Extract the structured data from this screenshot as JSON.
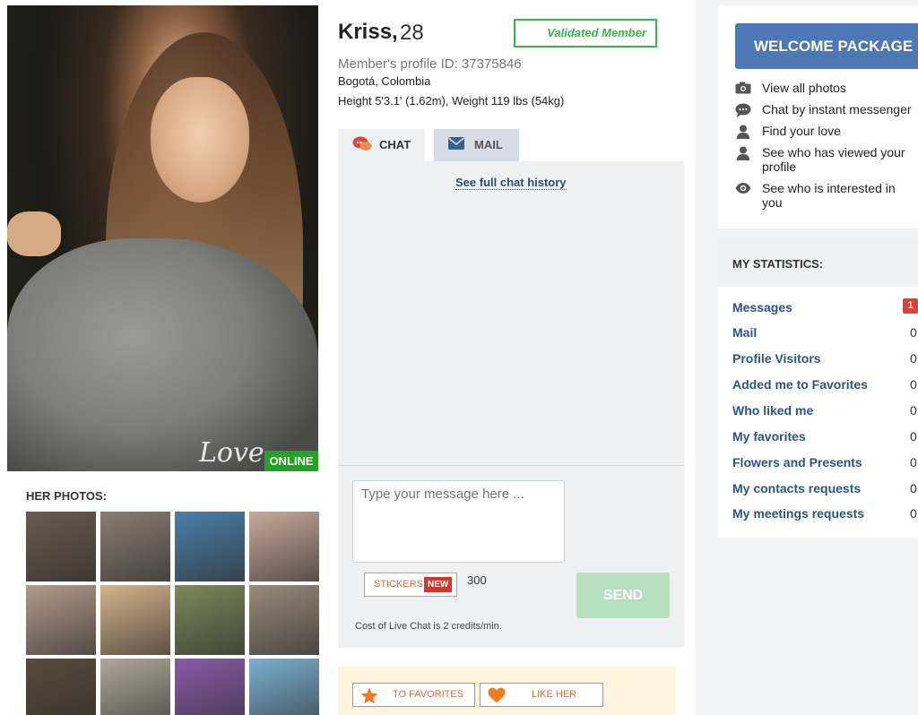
{
  "profile": {
    "name": "Kriss,",
    "age": "28",
    "validated_label": "Validated Member",
    "profile_id": "Member's profile ID: 37375846",
    "location": "Bogotá, Colombia",
    "measurements": "Height 5'3.1' (1.62m), Weight 119 lbs (54kg)"
  },
  "photo": {
    "watermark": "Love.",
    "status": "ONLINE"
  },
  "photos": {
    "title": "HER PHOTOS:",
    "thumb_colors": [
      "#6b5a4d",
      "#8a7d72",
      "#4b7fa8",
      "#c9a89a",
      "#b59a8a",
      "#d4b48a",
      "#7a8a5a",
      "#9a8a7a",
      "#5a4a3a",
      "#b0a898",
      "#8a5aa8",
      "#7ab0d0"
    ]
  },
  "tabs": {
    "chat": "CHAT",
    "mail": "MAIL"
  },
  "chat": {
    "history_link": "See full chat history",
    "input_placeholder": "Type your message here ...",
    "stickers_label": "STICKERS",
    "new_badge": "NEW",
    "char_count": "300",
    "send_label": "SEND",
    "cost_note": "Cost of Live Chat is 2 credits/min."
  },
  "actions": {
    "favorites": "TO FAVORITES",
    "like": "LIKE HER"
  },
  "welcome": {
    "button": "WELCOME PACKAGE",
    "perks": [
      {
        "label": "View all photos",
        "icon": "camera-icon"
      },
      {
        "label": "Chat by instant messenger",
        "icon": "chat-bubble-icon"
      },
      {
        "label": "Find your love",
        "icon": "user-icon"
      },
      {
        "label": "See who has viewed your profile",
        "icon": "user-icon"
      },
      {
        "label": "See who is interested in you",
        "icon": "eye-icon"
      }
    ]
  },
  "stats": {
    "title": "MY STATISTICS:",
    "rows": [
      {
        "label": "Messages",
        "value": "1",
        "highlight": true
      },
      {
        "label": "Mail",
        "value": "0"
      },
      {
        "label": "Profile Visitors",
        "value": "0"
      },
      {
        "label": "Added me to Favorites",
        "value": "0"
      },
      {
        "label": "Who liked me",
        "value": "0"
      },
      {
        "label": "My favorites",
        "value": "0"
      },
      {
        "label": "Flowers and Presents",
        "value": "0"
      },
      {
        "label": "My contacts requests",
        "value": "0"
      },
      {
        "label": "My meetings requests",
        "value": "0"
      }
    ]
  },
  "colors": {
    "online": "#23a326",
    "validated": "#3bb54a",
    "welcome_button": "#4e77b5",
    "send_disabled": "#b5dfbd",
    "stat_link": "#2a5485",
    "badge_red": "#e04235",
    "accent_orange": "#e06a2c"
  }
}
